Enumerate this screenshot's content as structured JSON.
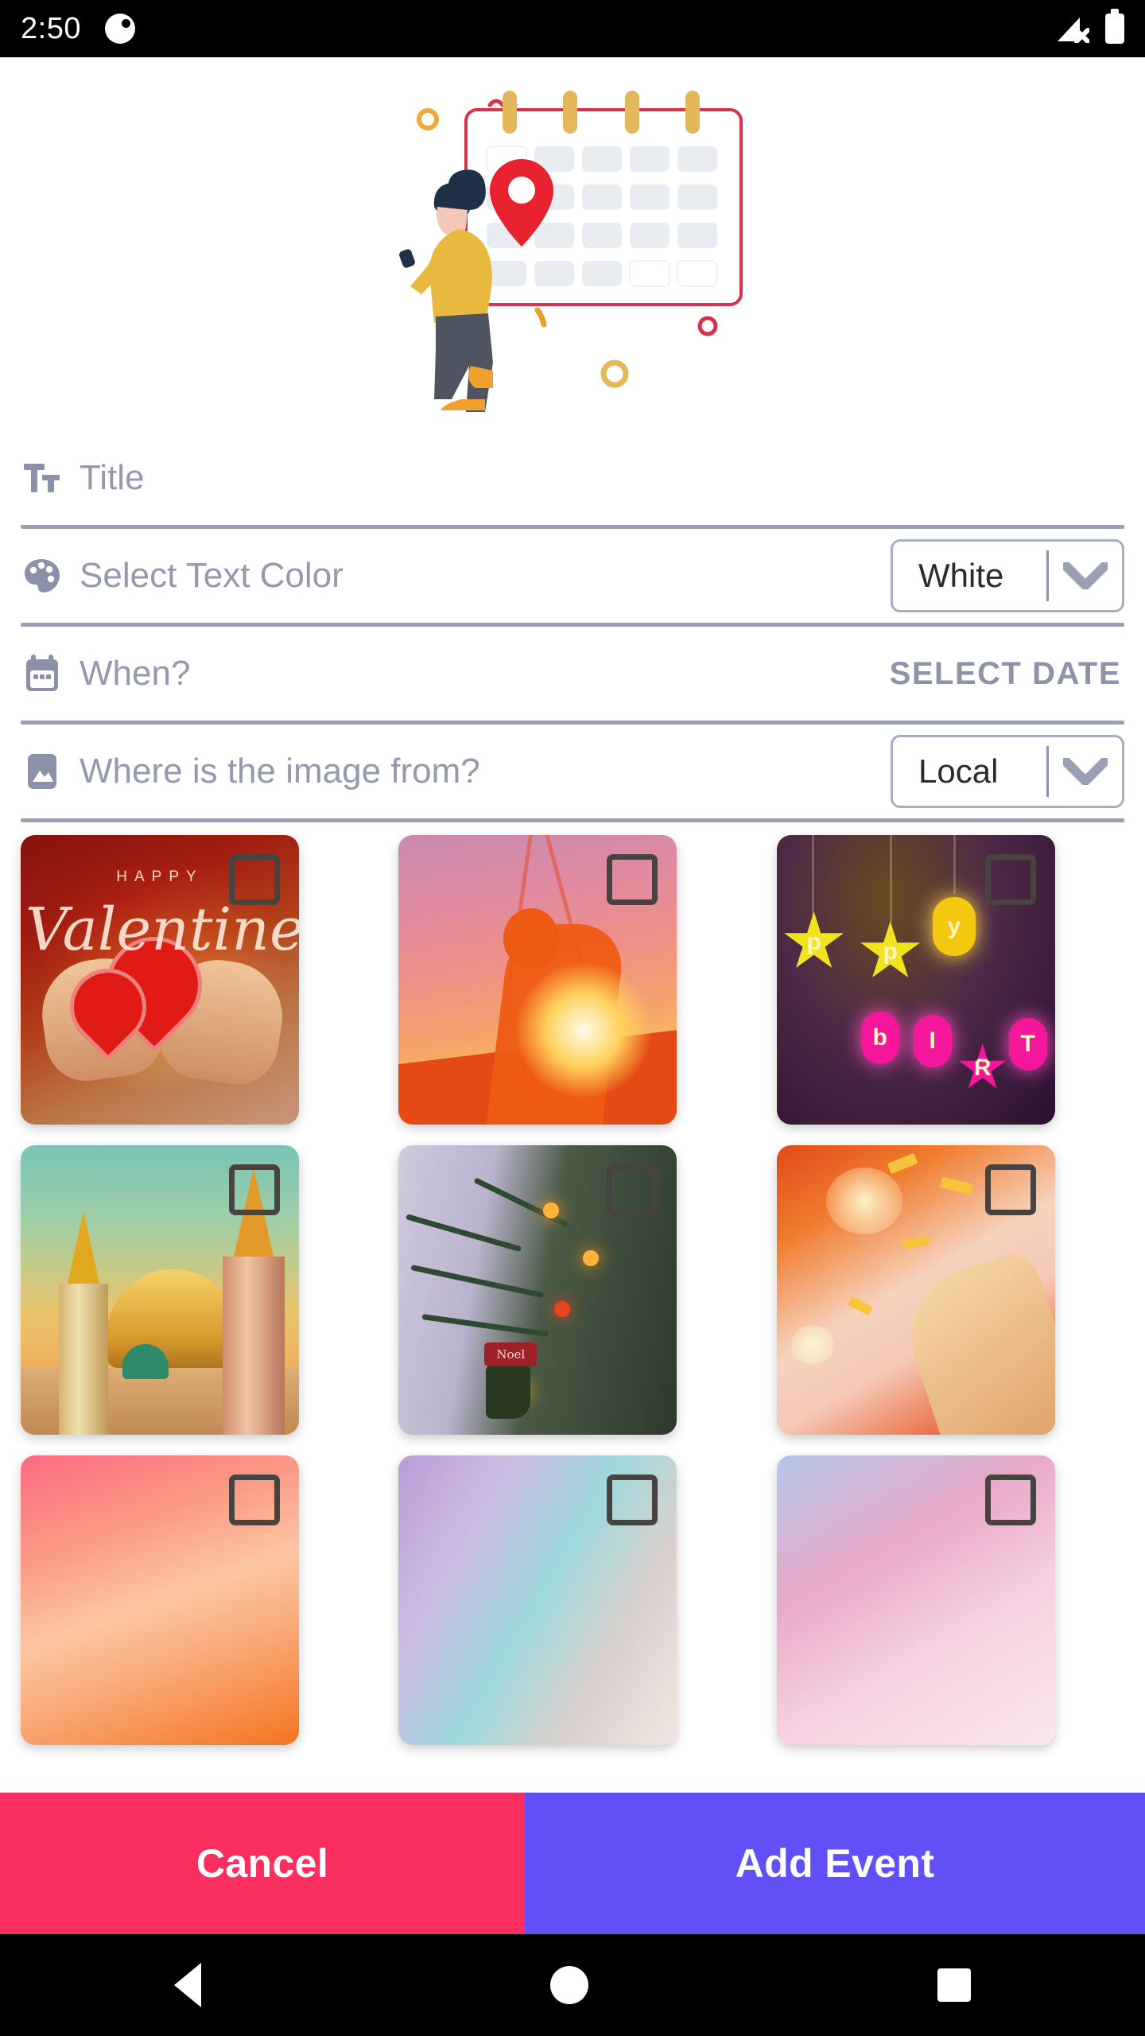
{
  "status_bar": {
    "time": "2:50",
    "app_icon": "app-notification-icon",
    "signal_icon": "signal-no-sim-icon",
    "battery_icon": "battery-full-icon"
  },
  "hero": {
    "illustration": "woman-with-calendar-and-location-pin-illustration",
    "calendar_border_color": "#d93149",
    "ring_color": "#e2b85a",
    "pin_color": "#e8222f",
    "sweater_color": "#e9b83f",
    "hair_color": "#1f3148",
    "pants_color": "#4e5560"
  },
  "form": {
    "rows": [
      {
        "icon": "text-format-icon",
        "label": "Title",
        "control": "input",
        "value": "",
        "placeholder": "Title"
      },
      {
        "icon": "color-palette-icon",
        "label": "Select Text Color",
        "control": "dropdown",
        "value": "White"
      },
      {
        "icon": "calendar-icon",
        "label": "When?",
        "control": "action",
        "value": "SELECT DATE"
      },
      {
        "icon": "image-icon",
        "label": "Where is the image from?",
        "control": "dropdown",
        "value": "Local"
      }
    ]
  },
  "gallery": {
    "checkbox_state": "unchecked",
    "items": [
      {
        "name": "valentine-hearts-thumbnail",
        "art": "art-valentine",
        "caption_top": "HAPPY",
        "caption_script": "Valentine"
      },
      {
        "name": "sunset-climber-thumbnail",
        "art": "art-sunset"
      },
      {
        "name": "happy-birthday-lights-thumbnail",
        "art": "art-bday"
      },
      {
        "name": "mosque-sunset-thumbnail",
        "art": "art-mosque"
      },
      {
        "name": "christmas-tree-noel-thumbnail",
        "art": "art-xmas",
        "ornament": "Noel"
      },
      {
        "name": "celebration-confetti-thumbnail",
        "art": "art-party"
      },
      {
        "name": "peach-gradient-thumbnail",
        "art": "art-peach"
      },
      {
        "name": "pastel-balloon-thumbnail",
        "art": "art-pastel"
      },
      {
        "name": "pink-veil-thumbnail",
        "art": "art-pinkveil"
      }
    ]
  },
  "actions": {
    "cancel_label": "Cancel",
    "cancel_color": "#fb2f5f",
    "add_label": "Add Event",
    "add_color": "#6150f6"
  },
  "nav_bar": {
    "back": "back-triangle-icon",
    "home": "home-circle-icon",
    "recents": "recents-square-icon"
  },
  "birthday_letters": [
    "p",
    "p",
    "y",
    "b",
    "I",
    "R",
    "T"
  ]
}
